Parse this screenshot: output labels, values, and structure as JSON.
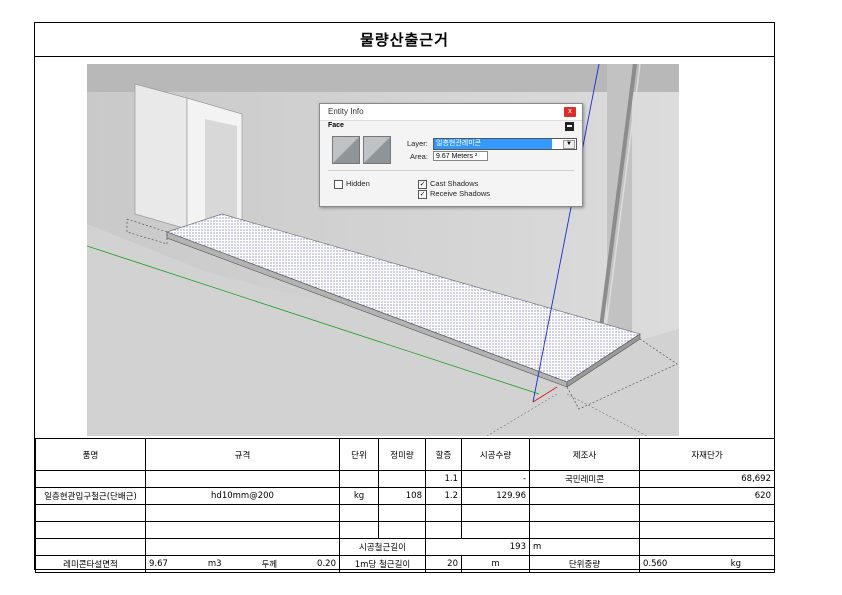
{
  "title": "물량산출근거",
  "entity_info": {
    "window_title": "Entity Info",
    "close_label": "x",
    "type_label": "Face",
    "layer_label": "Layer:",
    "layer_value": "일층현관레미콘",
    "area_label": "Area:",
    "area_value": "9.67 Meters ²",
    "hidden_label": "Hidden",
    "cast_shadows_label": "Cast Shadows",
    "receive_shadows_label": "Receive Shadows",
    "check_mark": "✓"
  },
  "table": {
    "headers": [
      "품명",
      "규격",
      "단위",
      "정미량",
      "할증",
      "시공수량",
      "제조사",
      "자재단가"
    ],
    "rows": [
      {
        "name": "",
        "spec": "",
        "unit": "",
        "net": "",
        "surcharge": "1.1",
        "qty": "-",
        "maker": "국민레미콘",
        "price": "68,692"
      },
      {
        "name": "일층현관입구철근(단배근)",
        "spec": "hd10mm@200",
        "unit": "kg",
        "net": "108",
        "surcharge": "1.2",
        "qty": "129.96",
        "maker": "",
        "price": "620"
      },
      {
        "name": "",
        "spec": "",
        "unit": "",
        "net": "",
        "surcharge": "",
        "qty": "",
        "maker": "",
        "price": ""
      },
      {
        "name": "",
        "spec": "",
        "unit": "",
        "net": "",
        "surcharge": "",
        "qty": "",
        "maker": "",
        "price": ""
      }
    ],
    "rebar_length_label": "시공철근길이",
    "rebar_length_value": "193",
    "rebar_length_unit": "m",
    "remicon_label": "레미콘타설면적",
    "remicon_area": "9.67",
    "remicon_unit": "m3",
    "thickness_label": "두께",
    "thickness_value": "0.20",
    "per_m_label": "1m당 철근길이",
    "per_m_value": "20",
    "per_m_unit": "m",
    "unit_weight_label": "단위중량",
    "unit_weight_value": "0.560",
    "unit_weight_unit": "kg"
  }
}
